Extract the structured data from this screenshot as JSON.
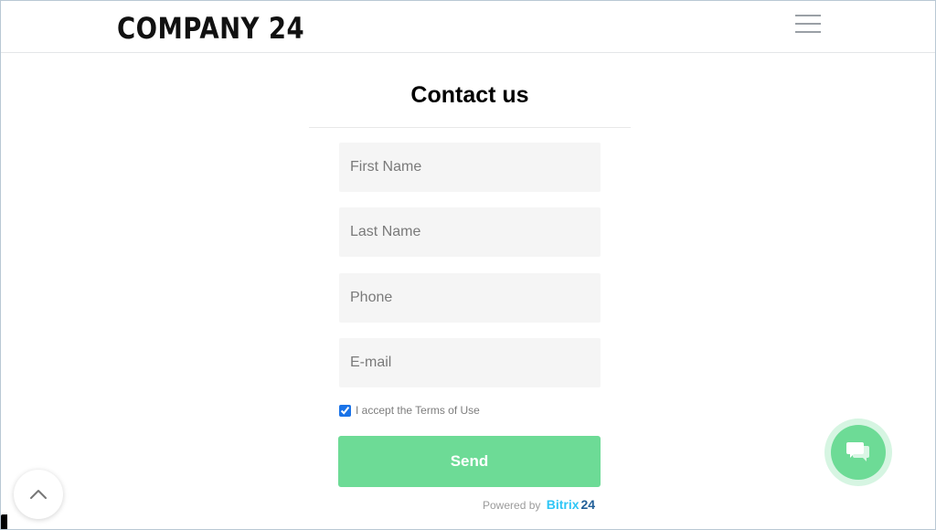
{
  "header": {
    "logo_text": "COMPANY 24",
    "menu_icon": "hamburger-icon"
  },
  "form": {
    "title": "Contact us",
    "fields": [
      {
        "placeholder": "First Name",
        "value": ""
      },
      {
        "placeholder": "Last Name",
        "value": ""
      },
      {
        "placeholder": "Phone",
        "value": ""
      },
      {
        "placeholder": "E-mail",
        "value": ""
      }
    ],
    "terms_label": "I accept the Terms of Use",
    "terms_checked": true,
    "send_label": "Send",
    "powered_by": "Powered by",
    "brand_part1": "Bitrix",
    "brand_part2": "24"
  },
  "widgets": {
    "scroll_top_icon": "chevron-up-icon",
    "chat_icon": "chat-bubbles-icon"
  },
  "colors": {
    "accent_green": "#6ddb96",
    "brand_blue": "#2fc6f6",
    "brand_dark_blue": "#215f98"
  }
}
